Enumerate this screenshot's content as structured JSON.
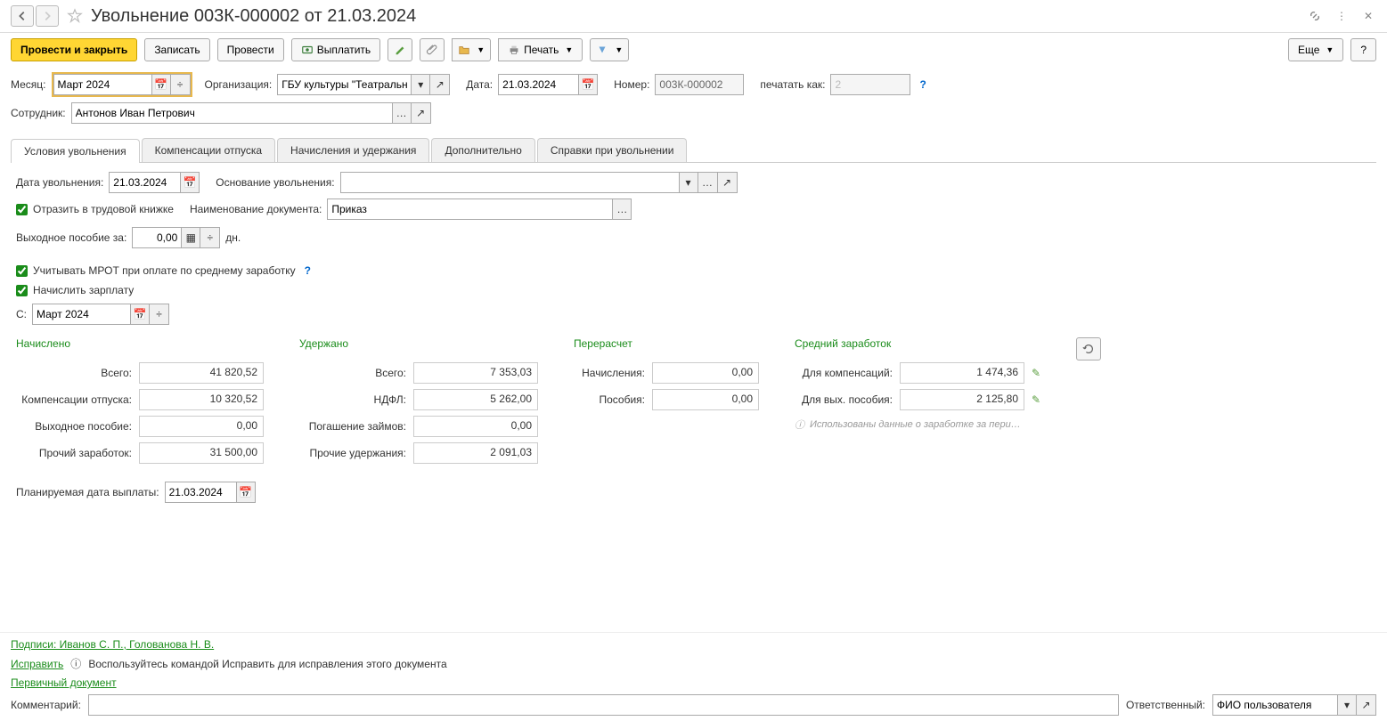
{
  "header": {
    "title": "Увольнение 003К-000002 от 21.03.2024"
  },
  "toolbar": {
    "post_close": "Провести и закрыть",
    "save": "Записать",
    "post": "Провести",
    "pay": "Выплатить",
    "print": "Печать",
    "more": "Еще",
    "help": "?"
  },
  "fields": {
    "month_label": "Месяц:",
    "month_value": "Март 2024",
    "org_label": "Организация:",
    "org_value": "ГБУ культуры \"Театральн",
    "date_label": "Дата:",
    "date_value": "21.03.2024",
    "number_label": "Номер:",
    "number_value": "003К-000002",
    "print_as_label": "печатать как:",
    "print_as_value": "2",
    "employee_label": "Сотрудник:",
    "employee_value": "Антонов Иван Петрович"
  },
  "tabs": [
    {
      "label": "Условия увольнения",
      "active": true
    },
    {
      "label": "Компенсации отпуска"
    },
    {
      "label": "Начисления и удержания"
    },
    {
      "label": "Дополнительно"
    },
    {
      "label": "Справки при увольнении"
    }
  ],
  "dismissal": {
    "date_label": "Дата увольнения:",
    "date_value": "21.03.2024",
    "reason_label": "Основание увольнения:",
    "reason_value": "",
    "workbook_check": "Отразить в трудовой книжке",
    "doc_name_label": "Наименование документа:",
    "doc_name_value": "Приказ",
    "severance_label": "Выходное пособие за:",
    "severance_value": "0,00",
    "severance_unit": "дн.",
    "mrot_check": "Учитывать МРОТ при оплате по среднему заработку",
    "salary_check": "Начислить зарплату",
    "from_label": "С:",
    "from_value": "Март 2024"
  },
  "summary": {
    "accrued": {
      "title": "Начислено",
      "total_label": "Всего:",
      "total": "41 820,52",
      "vacation_label": "Компенсации отпуска:",
      "vacation": "10 320,52",
      "severance_label": "Выходное пособие:",
      "severance": "0,00",
      "other_label": "Прочий заработок:",
      "other": "31 500,00"
    },
    "withheld": {
      "title": "Удержано",
      "total_label": "Всего:",
      "total": "7 353,03",
      "ndfl_label": "НДФЛ:",
      "ndfl": "5 262,00",
      "loans_label": "Погашение займов:",
      "loans": "0,00",
      "other_label": "Прочие удержания:",
      "other": "2 091,03"
    },
    "recalc": {
      "title": "Перерасчет",
      "accruals_label": "Начисления:",
      "accruals": "0,00",
      "benefits_label": "Пособия:",
      "benefits": "0,00"
    },
    "average": {
      "title": "Средний заработок",
      "comp_label": "Для компенсаций:",
      "comp": "1 474,36",
      "sev_label": "Для вых. пособия:",
      "sev": "2 125,80",
      "info": "Использованы данные о заработке за пери…"
    }
  },
  "planned_pay": {
    "label": "Планируемая дата выплаты:",
    "value": "21.03.2024"
  },
  "footer": {
    "signatures": "Подписи: Иванов С. П., Голованова Н. В.",
    "fix_link": "Исправить",
    "fix_hint": "Воспользуйтесь командой Исправить для исправления этого документа",
    "primary_doc": "Первичный документ",
    "comment_label": "Комментарий:",
    "responsible_label": "Ответственный:",
    "responsible_value": "ФИО пользователя"
  }
}
